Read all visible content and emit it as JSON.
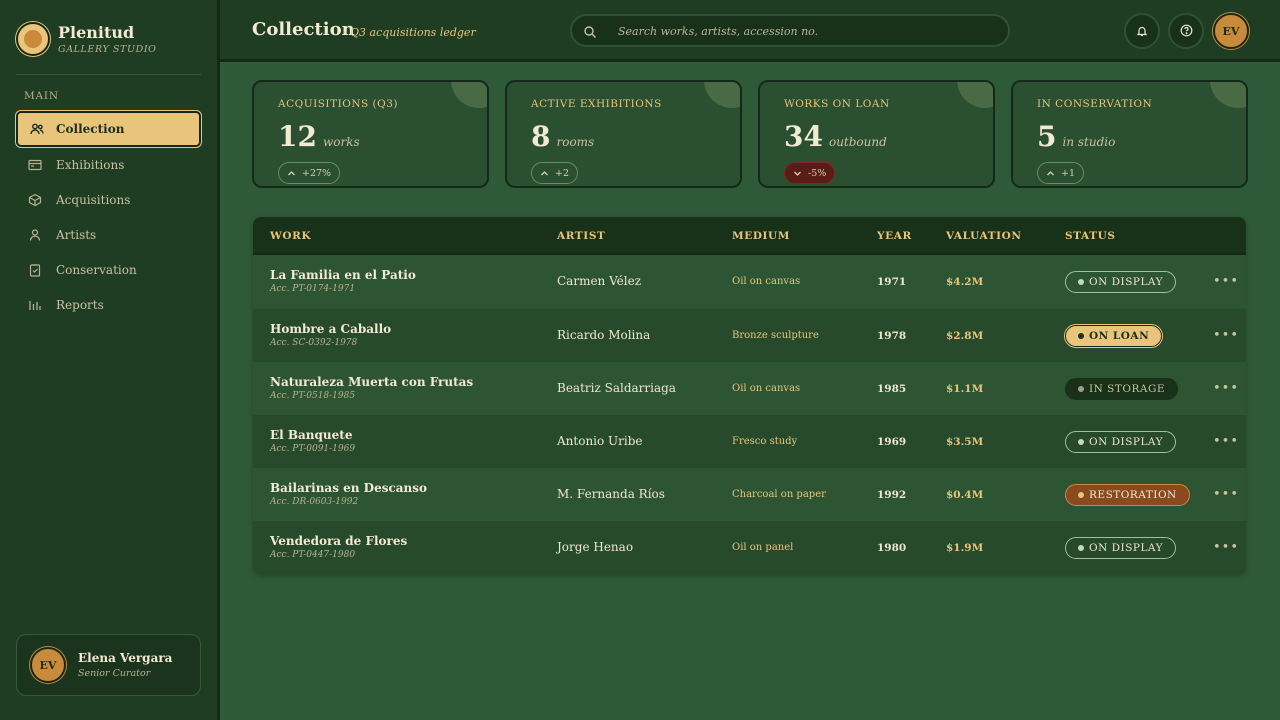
{
  "brand": {
    "name": "Plenitud",
    "subtitle": "GALLERY STUDIO"
  },
  "sidebar": {
    "heading": "MAIN",
    "items": [
      {
        "label": "Collection",
        "icon": "users-icon",
        "active": true
      },
      {
        "label": "Exhibitions",
        "icon": "exhibition-icon"
      },
      {
        "label": "Acquisitions",
        "icon": "box-icon"
      },
      {
        "label": "Artists",
        "icon": "person-icon"
      },
      {
        "label": "Conservation",
        "icon": "clipboard-check-icon"
      },
      {
        "label": "Reports",
        "icon": "bar-chart-icon"
      }
    ]
  },
  "user": {
    "initials": "EV",
    "name": "Elena Vergara",
    "role": "Senior Curator"
  },
  "header": {
    "title": "Collection",
    "subtitle": "· Q3 acquisitions ledger",
    "search_placeholder": "Search works, artists, accession no.",
    "avatar_initials": "EV"
  },
  "stats": [
    {
      "label": "ACQUISITIONS (Q3)",
      "value": "12",
      "unit": "works",
      "trend": "+27%",
      "direction": "up"
    },
    {
      "label": "ACTIVE EXHIBITIONS",
      "value": "8",
      "unit": "rooms",
      "trend": "+2",
      "direction": "up"
    },
    {
      "label": "WORKS ON LOAN",
      "value": "34",
      "unit": "outbound",
      "trend": "-5%",
      "direction": "down"
    },
    {
      "label": "IN CONSERVATION",
      "value": "5",
      "unit": "in studio",
      "trend": "+1",
      "direction": "up"
    }
  ],
  "table": {
    "columns": [
      "WORK",
      "ARTIST",
      "MEDIUM",
      "YEAR",
      "VALUATION",
      "STATUS"
    ],
    "rows": [
      {
        "title": "La Familia en el Patio",
        "acc": "Acc. PT-0174-1971",
        "artist": "Carmen Vélez",
        "medium": "Oil on canvas",
        "year": "1971",
        "valuation": "$4.2M",
        "status": "ON DISPLAY",
        "status_type": "display"
      },
      {
        "title": "Hombre a Caballo",
        "acc": "Acc. SC-0392-1978",
        "artist": "Ricardo Molina",
        "medium": "Bronze sculpture",
        "year": "1978",
        "valuation": "$2.8M",
        "status": "ON LOAN",
        "status_type": "loan"
      },
      {
        "title": "Naturaleza Muerta con Frutas",
        "acc": "Acc. PT-0518-1985",
        "artist": "Beatriz Saldarriaga",
        "medium": "Oil on canvas",
        "year": "1985",
        "valuation": "$1.1M",
        "status": "IN STORAGE",
        "status_type": "storage"
      },
      {
        "title": "El Banquete",
        "acc": "Acc. PT-0091-1969",
        "artist": "Antonio Uribe",
        "medium": "Fresco study",
        "year": "1969",
        "valuation": "$3.5M",
        "status": "ON DISPLAY",
        "status_type": "display"
      },
      {
        "title": "Bailarinas en Descanso",
        "acc": "Acc. DR-0603-1992",
        "artist": "M. Fernanda Ríos",
        "medium": "Charcoal on paper",
        "year": "1992",
        "valuation": "$0.4M",
        "status": "RESTORATION",
        "status_type": "restoration"
      },
      {
        "title": "Vendedora de Flores",
        "acc": "Acc. PT-0447-1980",
        "artist": "Jorge Henao",
        "medium": "Oil on panel",
        "year": "1980",
        "valuation": "$1.9M",
        "status": "ON DISPLAY",
        "status_type": "display"
      }
    ]
  },
  "colors": {
    "accent": "#e8c57a",
    "background": "#2f5a39",
    "sidebar": "#1f3d22",
    "restoration": "#8a4a1f",
    "loss": "#5a1c16"
  }
}
